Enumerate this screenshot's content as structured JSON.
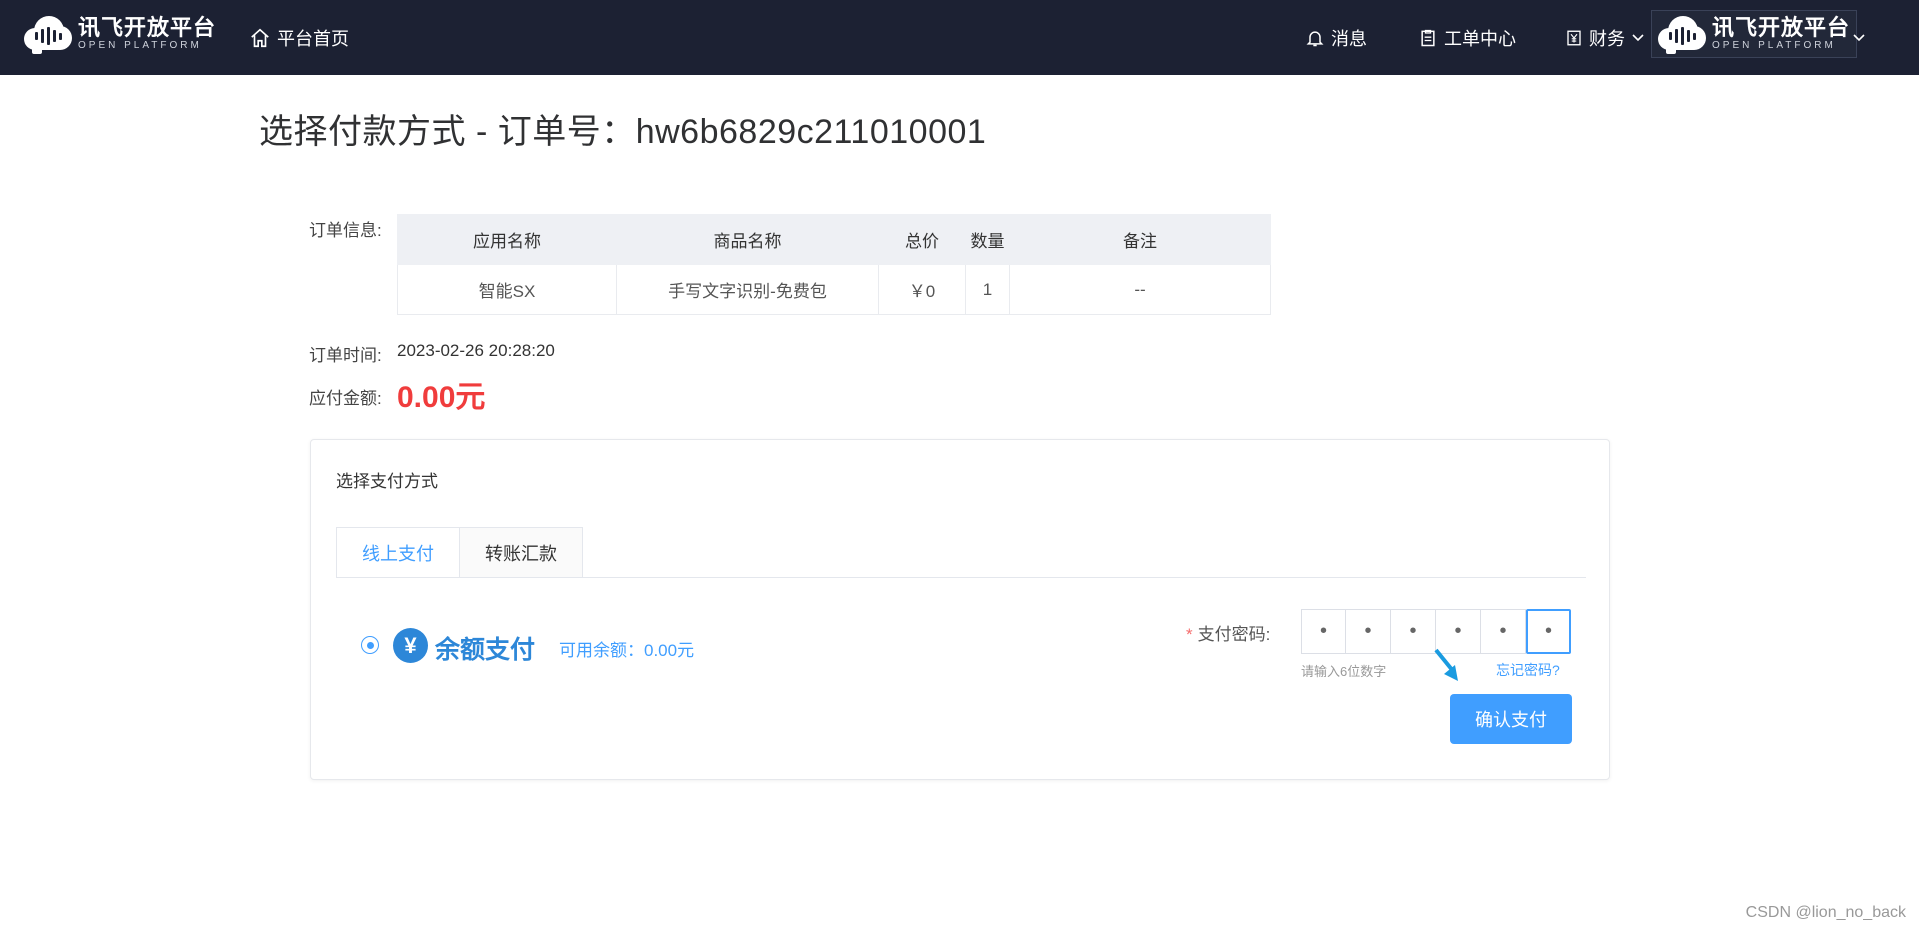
{
  "header": {
    "logo_cn": "讯飞开放平台",
    "logo_en": "OPEN PLATFORM",
    "home_label": "平台首页",
    "nav": {
      "messages": "消息",
      "tickets": "工单中心",
      "finance": "财务"
    },
    "account_logo_cn": "讯飞开放平台",
    "account_logo_en": "OPEN PLATFORM"
  },
  "page": {
    "title": "选择付款方式 - 订单号：hw6b6829c211010001"
  },
  "order": {
    "info_label": "订单信息:",
    "columns": [
      "应用名称",
      "商品名称",
      "总价",
      "数量",
      "备注"
    ],
    "row": [
      "智能SX",
      "手写文字识别-免费包",
      "￥0",
      "1",
      "--"
    ],
    "time_label": "订单时间:",
    "time_value": "2023-02-26 20:28:20",
    "amount_label": "应付金额:",
    "amount_value": "0.00元"
  },
  "payment": {
    "card_title": "选择支付方式",
    "tabs": [
      "线上支付",
      "转账汇款"
    ],
    "active_tab": 0,
    "yen_symbol": "¥",
    "method_label": "余额支付",
    "available_balance": "可用余额：0.00元",
    "password_label": "支付密码:",
    "password_dots": [
      "•",
      "•",
      "•",
      "•",
      "•",
      "•"
    ],
    "password_hint": "请输入6位数字",
    "forgot_password": "忘记密码?",
    "confirm_label": "确认支付"
  },
  "watermark": "CSDN @lion_no_back",
  "colors": {
    "topbar": "#1c2133",
    "accent": "#409eff",
    "amount": "#f03c3c",
    "balance_icon": "#2d87d8"
  }
}
